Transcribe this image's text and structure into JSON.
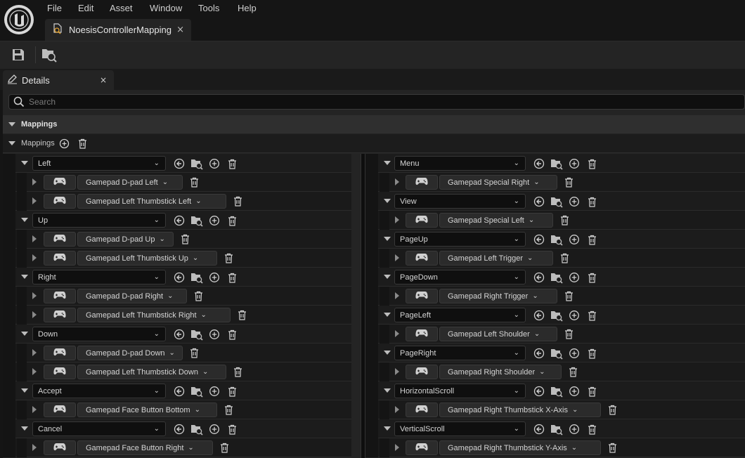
{
  "app": {
    "logo_icon": "unreal-logo-icon"
  },
  "menu": [
    "File",
    "Edit",
    "Asset",
    "Window",
    "Tools",
    "Help"
  ],
  "document_tab": {
    "label": "NoesisControllerMapping",
    "close": "×"
  },
  "details_tab": {
    "label": "Details",
    "close": "×"
  },
  "search": {
    "placeholder": "Search",
    "value": ""
  },
  "category": {
    "label": "Mappings"
  },
  "array": {
    "label": "Mappings"
  },
  "left_mappings": [
    {
      "action": "Left",
      "keys": [
        "Gamepad D-pad Left",
        "Gamepad Left Thumbstick Left"
      ]
    },
    {
      "action": "Up",
      "keys": [
        "Gamepad D-pad Up",
        "Gamepad Left Thumbstick Up"
      ]
    },
    {
      "action": "Right",
      "keys": [
        "Gamepad D-pad Right",
        "Gamepad Left Thumbstick Right"
      ]
    },
    {
      "action": "Down",
      "keys": [
        "Gamepad D-pad Down",
        "Gamepad Left Thumbstick Down"
      ]
    },
    {
      "action": "Accept",
      "keys": [
        "Gamepad Face Button Bottom"
      ]
    },
    {
      "action": "Cancel",
      "keys": [
        "Gamepad Face Button Right"
      ]
    }
  ],
  "right_mappings": [
    {
      "action": "Menu",
      "keys": [
        "Gamepad Special Right"
      ]
    },
    {
      "action": "View",
      "keys": [
        "Gamepad Special Left"
      ]
    },
    {
      "action": "PageUp",
      "keys": [
        "Gamepad Left Trigger"
      ]
    },
    {
      "action": "PageDown",
      "keys": [
        "Gamepad Right Trigger"
      ]
    },
    {
      "action": "PageLeft",
      "keys": [
        "Gamepad Left Shoulder"
      ]
    },
    {
      "action": "PageRight",
      "keys": [
        "Gamepad Right Shoulder"
      ]
    },
    {
      "action": "HorizontalScroll",
      "keys": [
        "Gamepad Right Thumbstick X-Axis"
      ]
    },
    {
      "action": "VerticalScroll",
      "keys": [
        "Gamepad Right Thumbstick Y-Axis"
      ]
    }
  ]
}
